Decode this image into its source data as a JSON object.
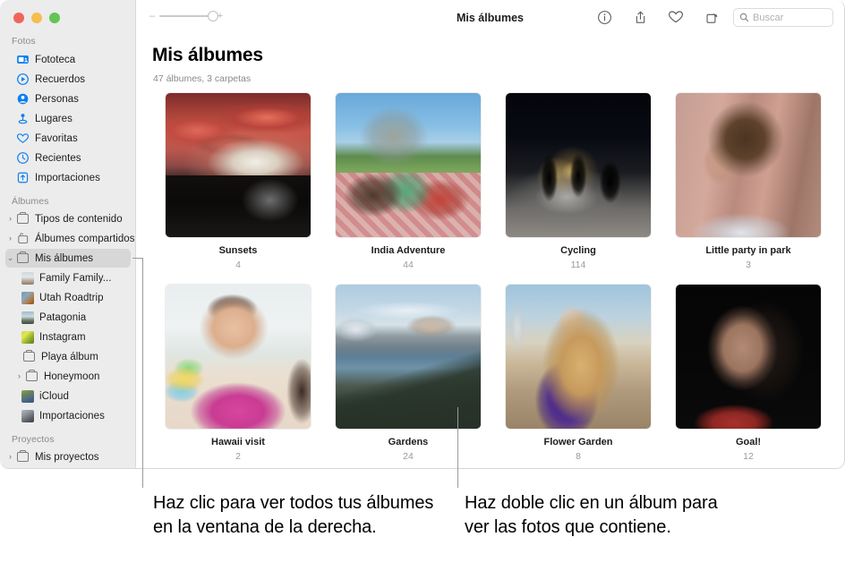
{
  "window": {
    "traffic_lights": [
      "close",
      "minimize",
      "zoom"
    ],
    "toolbar": {
      "title": "Mis álbumes",
      "zoom_out_label": "–",
      "zoom_in_label": "+",
      "zoom_value": 100,
      "icons": [
        "info-icon",
        "share-icon",
        "favorite-heart-icon",
        "rotate-icon"
      ],
      "search_placeholder": "Buscar",
      "search_value": ""
    }
  },
  "sidebar": {
    "sections": [
      {
        "title": "Fotos",
        "items": [
          {
            "label": "Fototeca",
            "icon": "photo-library-icon"
          },
          {
            "label": "Recuerdos",
            "icon": "memories-icon"
          },
          {
            "label": "Personas",
            "icon": "people-icon"
          },
          {
            "label": "Lugares",
            "icon": "places-pin-icon"
          },
          {
            "label": "Favoritas",
            "icon": "heart-icon"
          },
          {
            "label": "Recientes",
            "icon": "clock-icon"
          },
          {
            "label": "Importaciones",
            "icon": "import-icon"
          }
        ]
      },
      {
        "title": "Álbumes",
        "items": [
          {
            "label": "Tipos de contenido",
            "icon": "folder-icon",
            "disclosure": "collapsed"
          },
          {
            "label": "Álbumes compartidos",
            "icon": "shared-album-icon",
            "disclosure": "collapsed"
          },
          {
            "label": "Mis álbumes",
            "icon": "folder-icon",
            "disclosure": "expanded",
            "selected": true
          },
          {
            "label": "Family Family...",
            "icon": "album-thumb-family",
            "indent": true
          },
          {
            "label": "Utah Roadtrip",
            "icon": "album-thumb-utah",
            "indent": true
          },
          {
            "label": "Patagonia",
            "icon": "album-thumb-patagonia",
            "indent": true
          },
          {
            "label": "Instagram",
            "icon": "album-thumb-instagram",
            "indent": true
          },
          {
            "label": "Playa álbum",
            "icon": "folder-icon",
            "indent": true
          },
          {
            "label": "Honeymoon",
            "icon": "folder-icon",
            "indent": true,
            "disclosure": "collapsed"
          },
          {
            "label": "iCloud",
            "icon": "album-thumb-icloud",
            "indent": true
          },
          {
            "label": "Importaciones",
            "icon": "album-thumb-imports",
            "indent": true
          }
        ]
      },
      {
        "title": "Proyectos",
        "items": [
          {
            "label": "Mis proyectos",
            "icon": "folder-icon",
            "disclosure": "collapsed"
          }
        ]
      }
    ]
  },
  "main": {
    "title": "Mis álbumes",
    "subtitle": "47 álbumes, 3 carpetas",
    "albums": [
      {
        "name": "Sunsets",
        "count": "4",
        "art": "ph-sunset"
      },
      {
        "name": "India Adventure",
        "count": "44",
        "art": "ph-india"
      },
      {
        "name": "Cycling",
        "count": "114",
        "art": "ph-cycle"
      },
      {
        "name": "Little party in park",
        "count": "3",
        "art": "ph-party"
      },
      {
        "name": "Hawaii visit",
        "count": "2",
        "art": "ph-hawaii"
      },
      {
        "name": "Gardens",
        "count": "24",
        "art": "ph-gardens"
      },
      {
        "name": "Flower Garden",
        "count": "8",
        "art": "ph-flower"
      },
      {
        "name": "Goal!",
        "count": "12",
        "art": "ph-goal"
      }
    ]
  },
  "callouts": [
    {
      "text": "Haz clic para ver todos tus álbumes en la ventana de la derecha."
    },
    {
      "text": "Haz doble clic en un álbum para ver las fotos que contiene."
    }
  ],
  "colors": {
    "accent": "#0a7ff2",
    "sidebar_bg": "#ececec",
    "selected_row": "#d7d7d7",
    "traffic_red": "#f1645c",
    "traffic_yellow": "#f6be4f",
    "traffic_green": "#62c554"
  }
}
